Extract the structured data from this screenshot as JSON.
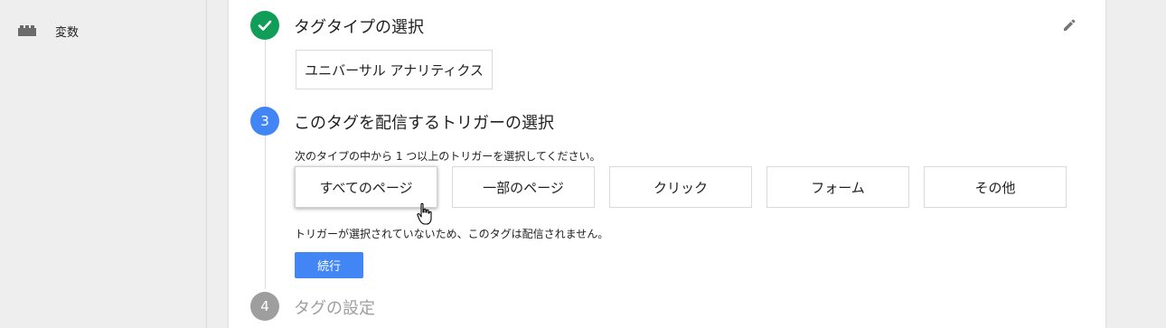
{
  "sidebar": {
    "items": [
      {
        "label": "変数",
        "icon": "blocks-icon"
      }
    ]
  },
  "steps": {
    "step2": {
      "title": "タグタイプの選択",
      "status": "completed",
      "selected_type": "ユニバーサル アナリティクス"
    },
    "step3": {
      "number": "3",
      "title": "このタグを配信するトリガーの選択",
      "instruction": "次のタイプの中から 1 つ以上のトリガーを選択してください。",
      "options": [
        "すべてのページ",
        "一部のページ",
        "クリック",
        "フォーム",
        "その他"
      ],
      "warning": "トリガーが選択されていないため、このタグは配信されません。",
      "continue_label": "続行"
    },
    "step4": {
      "number": "4",
      "title": "タグの設定"
    }
  },
  "colors": {
    "completed": "#0f9d58",
    "active": "#4285f4",
    "inactive": "#9e9e9e",
    "button": "#4285f4"
  }
}
